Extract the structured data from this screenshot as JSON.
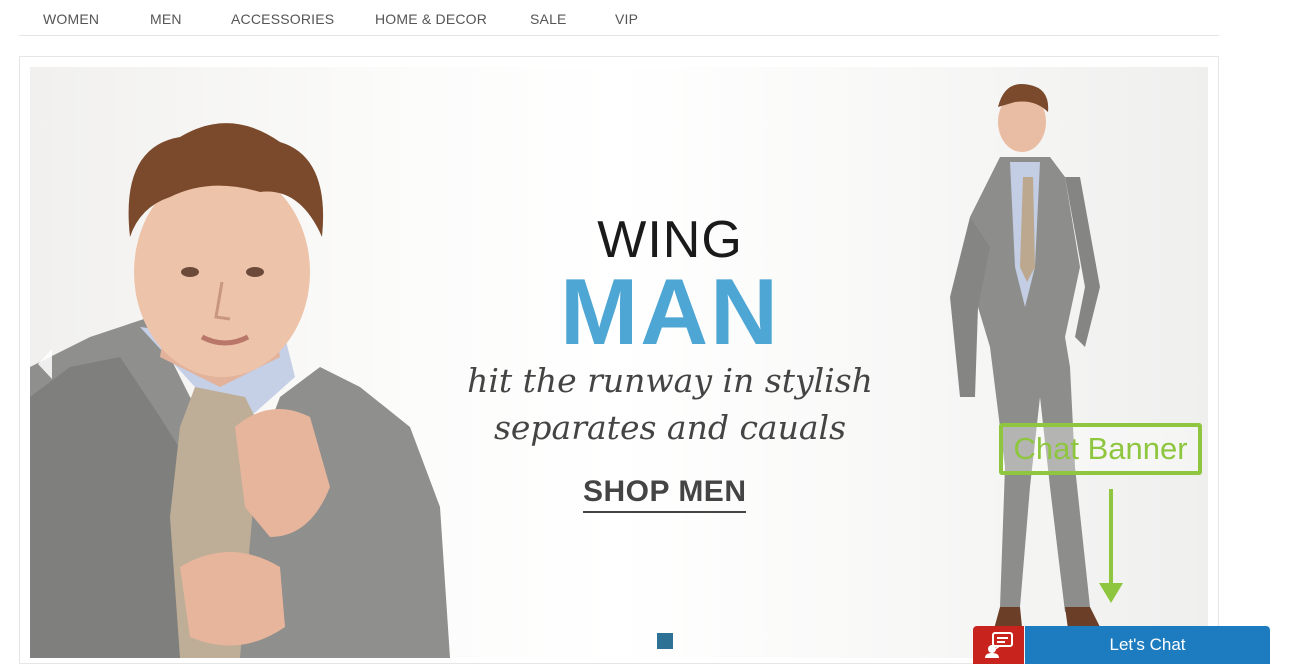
{
  "nav": {
    "items": [
      {
        "label": "WOMEN"
      },
      {
        "label": "MEN"
      },
      {
        "label": "ACCESSORIES"
      },
      {
        "label": "HOME & DECOR"
      },
      {
        "label": "SALE"
      },
      {
        "label": "VIP"
      }
    ]
  },
  "hero": {
    "headline_top": "WING",
    "headline_main": "MAN",
    "tagline_line1": "hit the runway in stylish",
    "tagline_line2": "separates and cauals",
    "cta_label": "SHOP MEN",
    "slides_total": 1,
    "active_slide": 1,
    "headline_main_color": "#4da6d3"
  },
  "annotation": {
    "label": "Chat Banner",
    "color": "#8fc63f"
  },
  "chat": {
    "button_label": "Let's Chat",
    "icon": "chat-bubbles-icon",
    "icon_bg": "#c8231c",
    "button_bg": "#1c7cbf"
  }
}
